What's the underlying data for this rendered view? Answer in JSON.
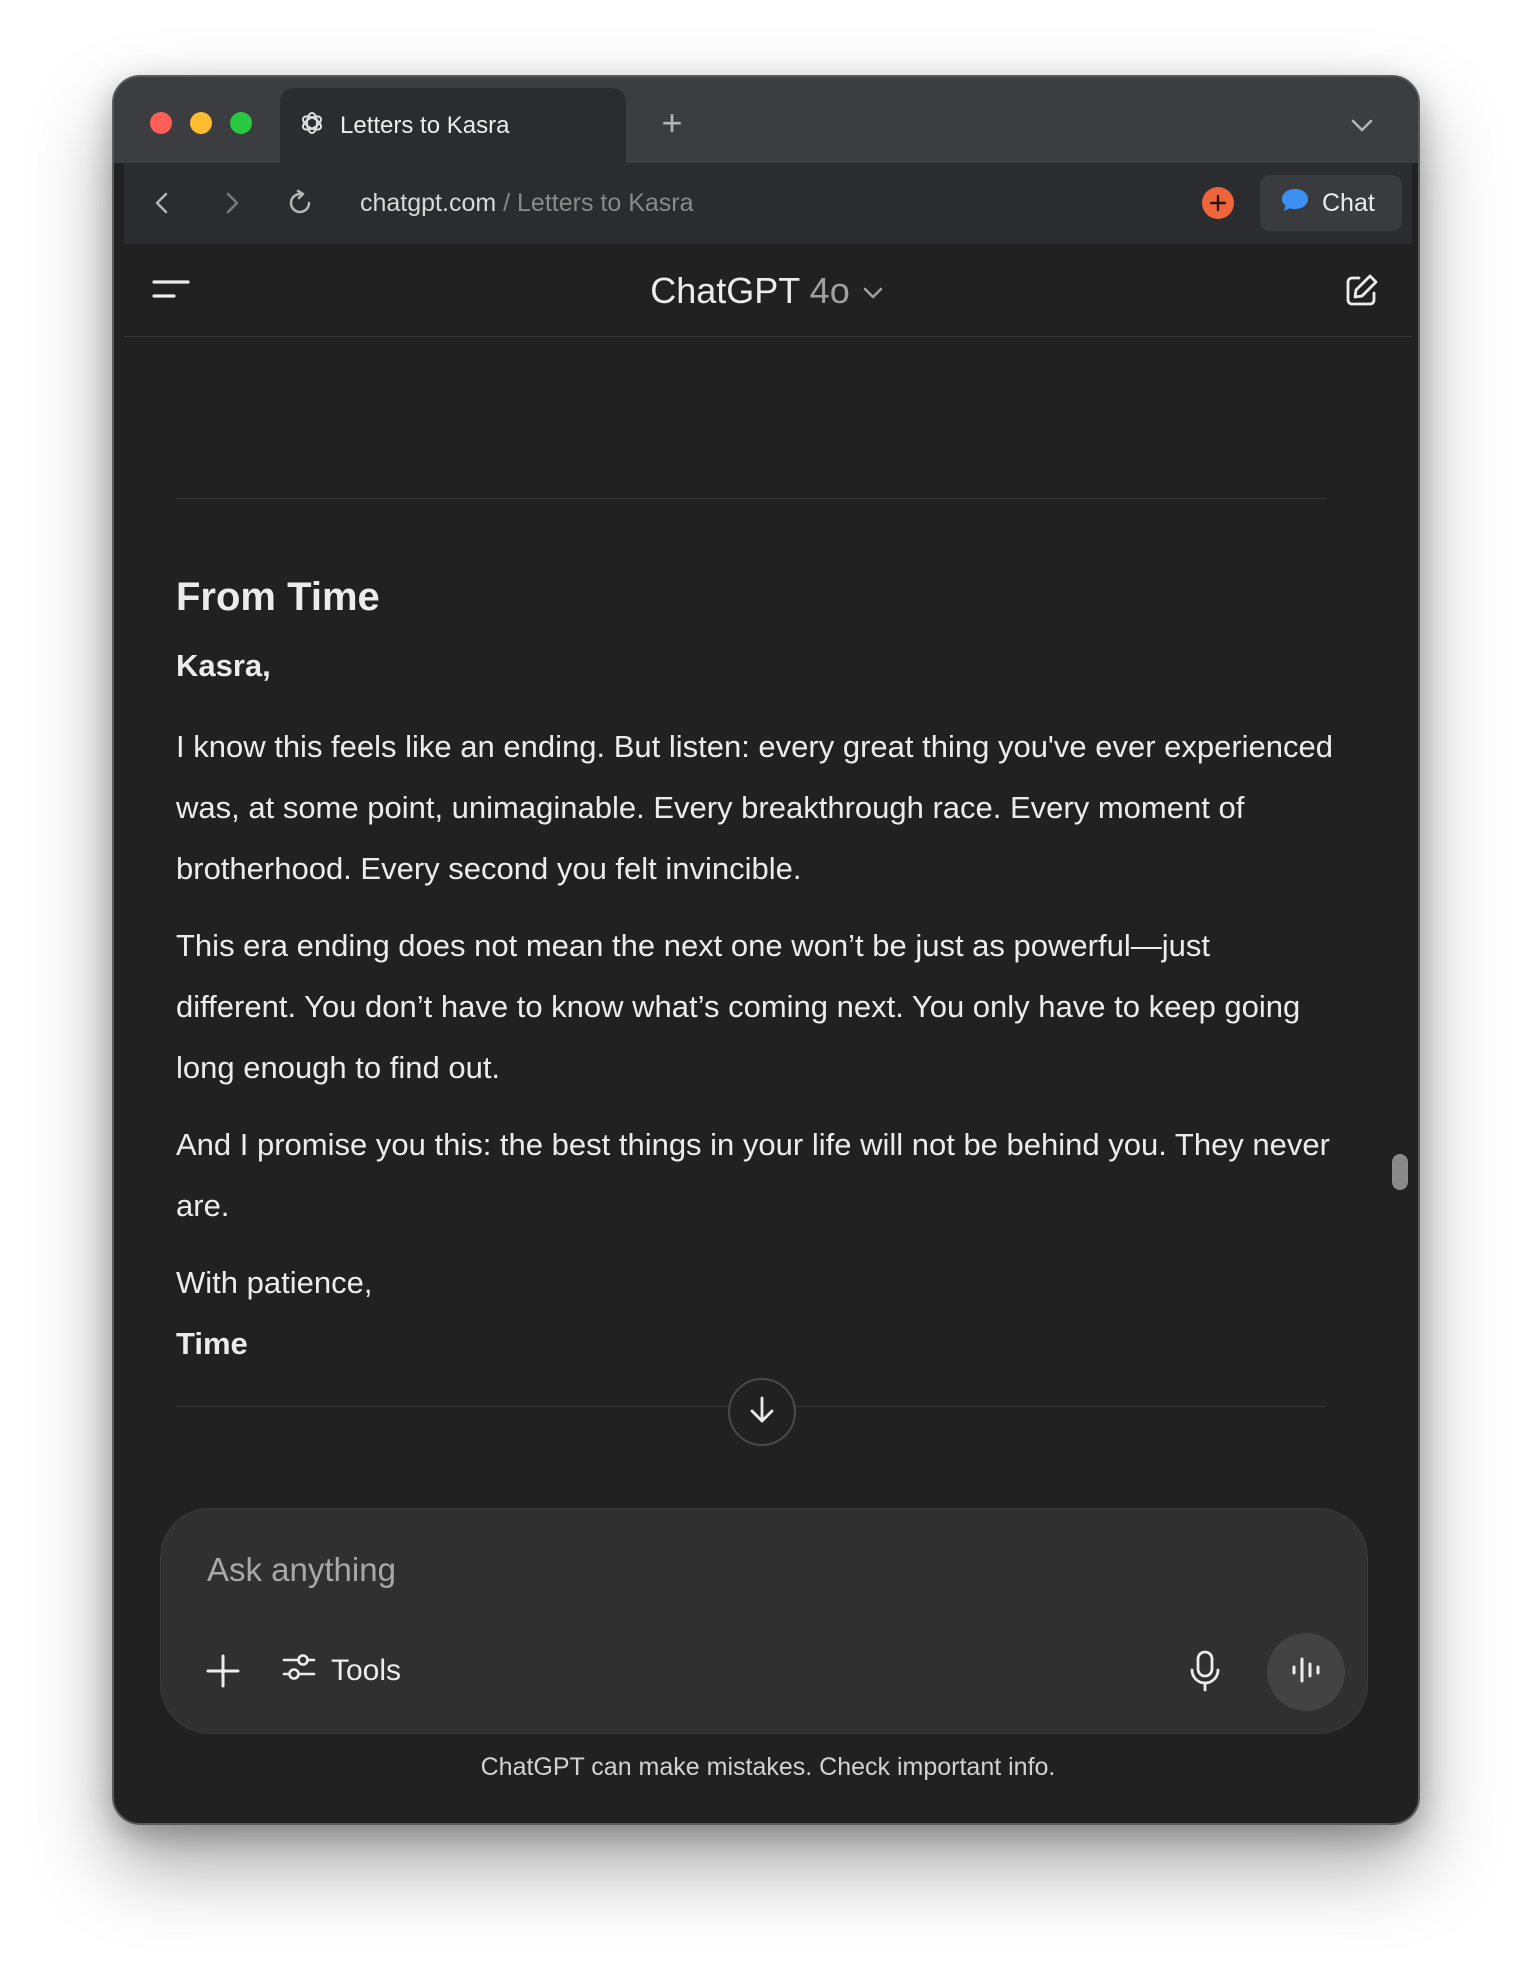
{
  "browser": {
    "tab_title": "Letters to Kasra",
    "new_tab_label": "+",
    "url_domain": "chatgpt.com",
    "url_separator": " / ",
    "url_path": "Letters to Kasra",
    "chat_button_label": "Chat"
  },
  "header": {
    "model_name": "ChatGPT",
    "model_version": "4o"
  },
  "letter": {
    "title": "From Time",
    "greeting": "Kasra,",
    "paragraphs": [
      "I know this feels like an ending. But listen: every great thing you've ever experienced was, at some point, unimaginable. Every breakthrough race. Every moment of brotherhood. Every second you felt invincible.",
      "This era ending does not mean the next one won’t be just as powerful—just different. You don’t have to know what’s coming next. You only have to keep going long enough to find out.",
      "And I promise you this: the best things in your life will not be behind you. They never are."
    ],
    "closing": "With patience,",
    "signature": "Time"
  },
  "composer": {
    "placeholder": "Ask anything",
    "value": "",
    "tools_label": "Tools"
  },
  "footer": {
    "disclaimer": "ChatGPT can make mistakes. Check important info."
  },
  "colors": {
    "background": "#212121",
    "composer": "#303030",
    "text": "#ececec",
    "extension_accent": "#f0643a",
    "chat_bubble_blue": "#3b8ff0"
  },
  "icons": {
    "tab_favicon": "openai-logo-icon",
    "back": "chevron-left-icon",
    "forward": "chevron-right-icon",
    "reload": "reload-icon",
    "extension": "plus-circle-icon",
    "chat": "chat-bubble-icon",
    "menu": "menu-icon",
    "new_chat": "compose-icon",
    "scroll_down": "arrow-down-icon",
    "attach": "plus-icon",
    "tools": "sliders-icon",
    "mic": "microphone-icon",
    "voice": "voice-waveform-icon"
  }
}
